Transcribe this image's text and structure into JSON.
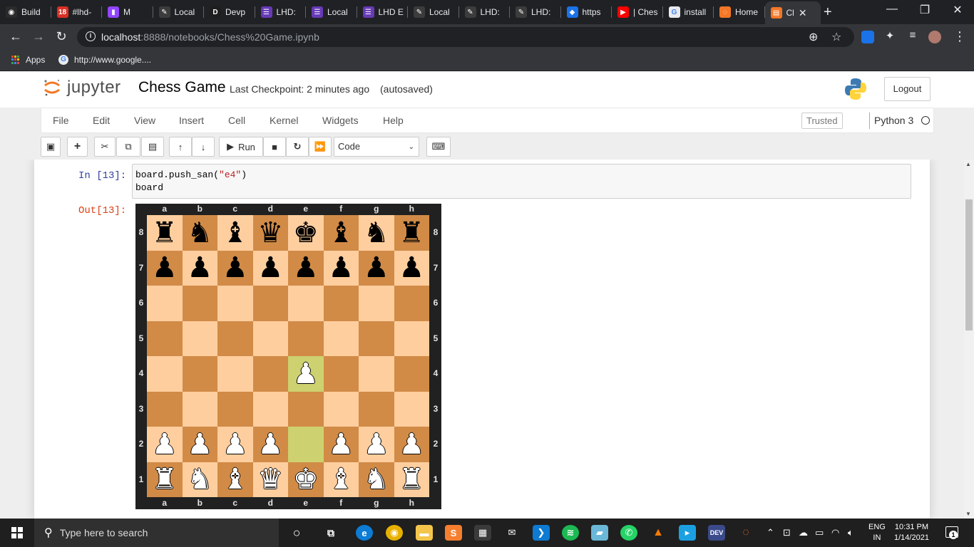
{
  "browser": {
    "tabs": [
      {
        "label": "Build",
        "icon": "github-icon",
        "color": "#2b2b2b",
        "glyph": "◉"
      },
      {
        "label": "#lhd-",
        "icon": "calendar-icon",
        "color": "#d93025",
        "glyph": "18"
      },
      {
        "label": "M",
        "icon": "twitch-icon",
        "color": "#9146ff",
        "glyph": "▮"
      },
      {
        "label": "Local",
        "icon": "pen-icon",
        "color": "#3c3c3c",
        "glyph": "✎"
      },
      {
        "label": "Devp",
        "icon": "dev-icon",
        "color": "#1e1e1e",
        "glyph": "D"
      },
      {
        "label": "LHD:",
        "icon": "form-icon",
        "color": "#673ab7",
        "glyph": "☰"
      },
      {
        "label": "Local",
        "icon": "form-icon",
        "color": "#673ab7",
        "glyph": "☰"
      },
      {
        "label": "LHD E",
        "icon": "form-icon",
        "color": "#673ab7",
        "glyph": "☰"
      },
      {
        "label": "Local",
        "icon": "pen-icon",
        "color": "#3c3c3c",
        "glyph": "✎"
      },
      {
        "label": "LHD:",
        "icon": "pen-icon",
        "color": "#3c3c3c",
        "glyph": "✎"
      },
      {
        "label": "LHD:",
        "icon": "pen-icon",
        "color": "#3c3c3c",
        "glyph": "✎"
      },
      {
        "label": "https",
        "icon": "diamond-icon",
        "color": "#1a73e8",
        "glyph": "◆"
      },
      {
        "label": "| Ches",
        "icon": "youtube-icon",
        "color": "#ff0000",
        "glyph": "▶"
      },
      {
        "label": "install",
        "icon": "google-icon",
        "color": "#e8eaed",
        "glyph": "G"
      },
      {
        "label": "Home",
        "icon": "jupyter-icon",
        "color": "#f37726",
        "glyph": "◌"
      },
      {
        "label": "Cl",
        "icon": "notebook-icon",
        "color": "#f37726",
        "glyph": "▤"
      }
    ],
    "url_host": "localhost",
    "url_path": ":8888/notebooks/Chess%20Game.ipynb",
    "bookmarks": [
      {
        "label": "Apps"
      },
      {
        "label": "http://www.google...."
      }
    ]
  },
  "jupyter": {
    "logo_text": "jupyter",
    "notebook_name": "Chess Game",
    "checkpoint": "Last Checkpoint: 2 minutes ago",
    "autosaved": "(autosaved)",
    "logout": "Logout",
    "menu": [
      "File",
      "Edit",
      "View",
      "Insert",
      "Cell",
      "Kernel",
      "Widgets",
      "Help"
    ],
    "trusted": "Trusted",
    "kernel": "Python 3",
    "run_label": "Run",
    "cell_type": "Code"
  },
  "cell": {
    "in_prompt": "In [13]:",
    "code_line1_pre": "board.push_san(",
    "code_line1_str": "\"e4\"",
    "code_line1_post": ")",
    "code_line2": "board",
    "out_prompt": "Out[13]:"
  },
  "board": {
    "files": [
      "a",
      "b",
      "c",
      "d",
      "e",
      "f",
      "g",
      "h"
    ],
    "ranks": [
      "8",
      "7",
      "6",
      "5",
      "4",
      "3",
      "2",
      "1"
    ],
    "rows": [
      [
        "r",
        "n",
        "b",
        "q",
        "k",
        "b",
        "n",
        "r"
      ],
      [
        "p",
        "p",
        "p",
        "p",
        "p",
        "p",
        "p",
        "p"
      ],
      [
        "",
        "",
        "",
        "",
        "",
        "",
        "",
        ""
      ],
      [
        "",
        "",
        "",
        "",
        "",
        "",
        "",
        ""
      ],
      [
        "",
        "",
        "",
        "",
        "P",
        "",
        "",
        ""
      ],
      [
        "",
        "",
        "",
        "",
        "",
        "",
        "",
        ""
      ],
      [
        "P",
        "P",
        "P",
        "P",
        "",
        "P",
        "P",
        "P"
      ],
      [
        "R",
        "N",
        "B",
        "Q",
        "K",
        "B",
        "N",
        "R"
      ]
    ],
    "highlight": [
      "e4",
      "e2"
    ],
    "colors": {
      "light": "#ffce9e",
      "dark": "#d18b47",
      "hl_light": "#cdd16f",
      "hl_dark": "#aaa23b"
    }
  },
  "taskbar": {
    "search_placeholder": "Type here to search",
    "lang_top": "ENG",
    "lang_bottom": "IN",
    "time": "10:31 PM",
    "date": "1/14/2021",
    "notifications": "1"
  }
}
